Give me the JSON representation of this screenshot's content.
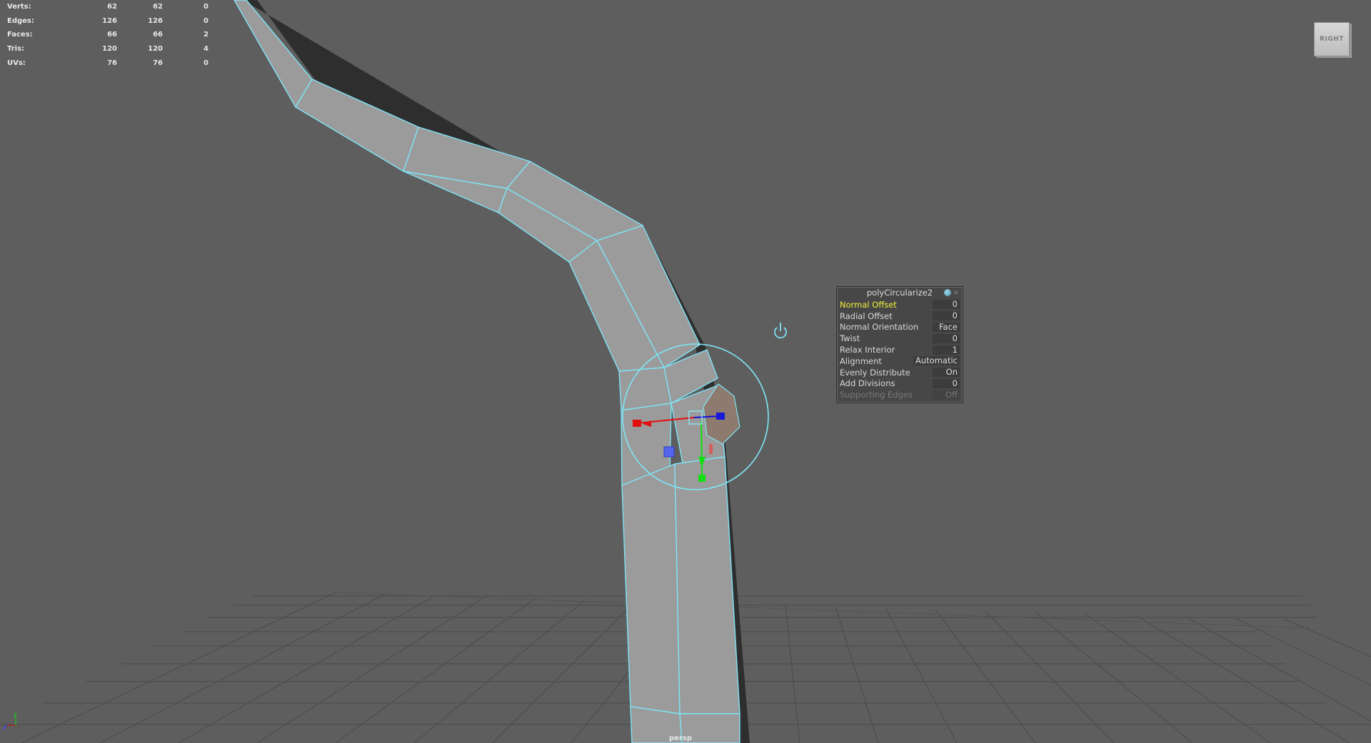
{
  "hud": {
    "rows": [
      {
        "label": "Verts:",
        "v1": "62",
        "v2": "62",
        "v3": "0"
      },
      {
        "label": "Edges:",
        "v1": "126",
        "v2": "126",
        "v3": "0"
      },
      {
        "label": "Faces:",
        "v1": "66",
        "v2": "66",
        "v3": "2"
      },
      {
        "label": "Tris:",
        "v1": "120",
        "v2": "120",
        "v3": "4"
      },
      {
        "label": "UVs:",
        "v1": "76",
        "v2": "76",
        "v3": "0"
      }
    ]
  },
  "viewcube": {
    "label": "RIGHT"
  },
  "camera": {
    "label": "persp"
  },
  "node_panel": {
    "title": "polyCircularize2",
    "attributes": [
      {
        "label": "Normal Offset",
        "value": "0",
        "state": "selected"
      },
      {
        "label": "Radial Offset",
        "value": "0",
        "state": "normal"
      },
      {
        "label": "Normal Orientation",
        "value": "Face",
        "state": "normal"
      },
      {
        "label": "Twist",
        "value": "0",
        "state": "normal"
      },
      {
        "label": "Relax Interior",
        "value": "1",
        "state": "normal"
      },
      {
        "label": "Alignment",
        "value": "Automatic",
        "state": "normal"
      },
      {
        "label": "Evenly Distribute",
        "value": "On",
        "state": "normal"
      },
      {
        "label": "Add Divisions",
        "value": "0",
        "state": "normal"
      },
      {
        "label": "Supporting Edges",
        "value": "Off",
        "state": "disabled"
      }
    ]
  },
  "axis_icon": {
    "y": "y",
    "z": "z"
  },
  "colors": {
    "background": "#5e5e5e",
    "mesh_face": "#9a9a9a",
    "mesh_edge": "#7fe3f5",
    "selected_label": "#f2ef3a",
    "x_axis": "#e01010",
    "y_axis": "#10e010",
    "z_axis": "#1010e0"
  },
  "icons": {
    "manipulator_toggle": "power-icon",
    "close": "close-icon",
    "minimize": "node-bullet-icon"
  }
}
